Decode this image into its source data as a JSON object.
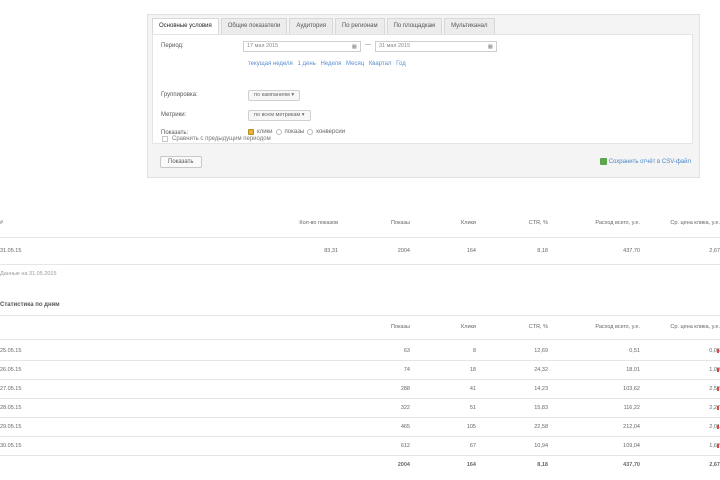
{
  "tabs": [
    "Основные условия",
    "Общие показатели",
    "Аудитория",
    "По регионам",
    "По площадкам",
    "Мультиканал"
  ],
  "filters": {
    "period_label": "Период:",
    "date_from": "17 мая 2015",
    "date_to": "31 мая 2015",
    "date_separator": "—",
    "quick_ranges": [
      "текущая неделя",
      "1 день",
      "Неделя",
      "Месяц",
      "Квартал",
      "Год"
    ],
    "row2_label": "Группировка:",
    "row2_value": "по кампаниям",
    "row3_label": "Метрики:",
    "row3_value": "по всем метрикам",
    "row4_label": "Показать:",
    "radio_options": [
      "клики",
      "показы",
      "конверсии"
    ],
    "checkbox_label": "Сравнить с предыдущим периодом",
    "show_button": "Показать",
    "saved_link": "Сохранить отчёт в CSV-файл"
  },
  "summary": {
    "headers": [
      "#",
      "Кол-во показов",
      "Показы",
      "Клики",
      "CTR, %",
      "Расход всего, у.е.",
      "Ср. цена клика, у.е."
    ],
    "row": [
      "31.05.15",
      "83,31",
      "2004",
      "164",
      "8,18",
      "437,70",
      "2,67"
    ]
  },
  "note": "Данные на 31.05.2015",
  "section_title": "Статистика по дням",
  "daily": {
    "headers": [
      "Показы",
      "Клики",
      "CTR, %",
      "Расход всего, у.е.",
      "Ср. цена клика, у.е."
    ],
    "rows": [
      {
        "date": "25.05.15",
        "v": [
          "63",
          "8",
          "12,69",
          "0,51",
          "0,06"
        ]
      },
      {
        "date": "26.05.15",
        "v": [
          "74",
          "18",
          "24,32",
          "18,01",
          "1,00"
        ]
      },
      {
        "date": "27.05.15",
        "v": [
          "288",
          "41",
          "14,23",
          "103,62",
          "2,52"
        ]
      },
      {
        "date": "28.05.15",
        "v": [
          "322",
          "51",
          "15,83",
          "116,22",
          "2,27"
        ]
      },
      {
        "date": "29.05.15",
        "v": [
          "465",
          "105",
          "22,58",
          "212,04",
          "2,01"
        ]
      },
      {
        "date": "30.05.15",
        "v": [
          "612",
          "67",
          "10,94",
          "109,04",
          "1,62"
        ]
      }
    ],
    "total": [
      "2004",
      "164",
      "8,18",
      "437,70",
      "2,67"
    ]
  }
}
